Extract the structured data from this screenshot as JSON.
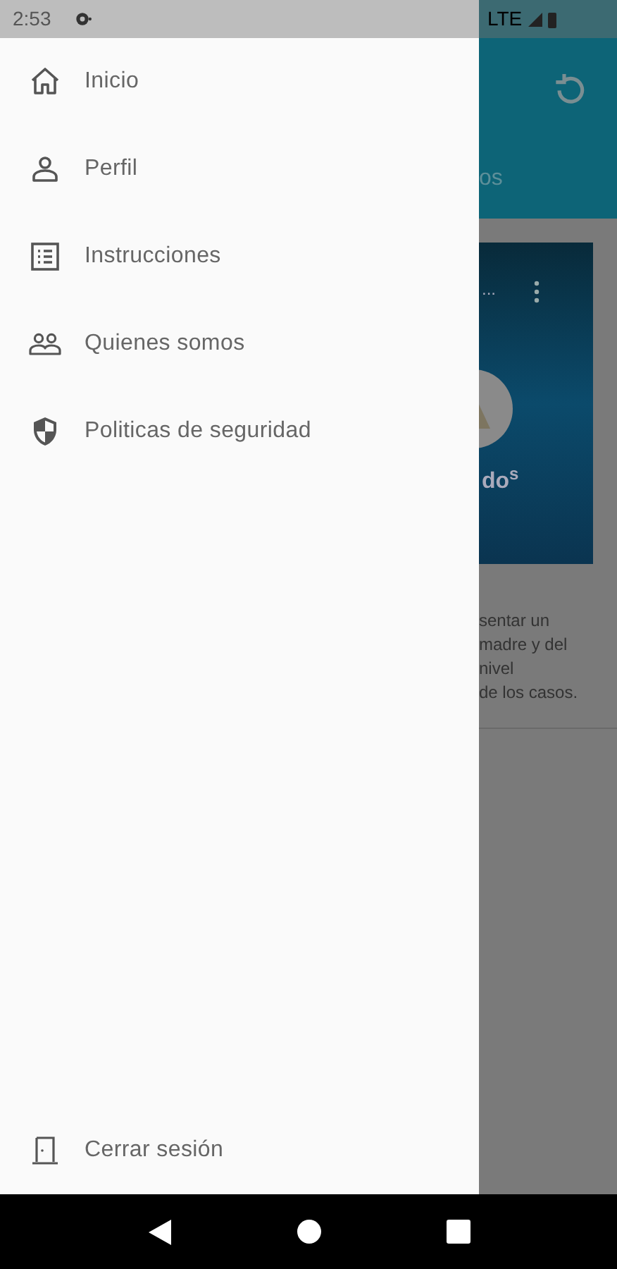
{
  "status_bar": {
    "time": "2:53",
    "network": "LTE"
  },
  "drawer": {
    "items": [
      {
        "kind": "home",
        "label": "Inicio"
      },
      {
        "kind": "person",
        "label": "Perfil"
      },
      {
        "kind": "list",
        "label": "Instrucciones"
      },
      {
        "kind": "people",
        "label": "Quienes somos"
      },
      {
        "kind": "shield",
        "label": "Politicas de seguridad"
      }
    ],
    "footer": {
      "kind": "door",
      "label": "Cerrar sesión"
    }
  },
  "background": {
    "tab_fragment": "os",
    "card": {
      "more": "...",
      "title_fragment": "do$^{s}$"
    },
    "text_lines": [
      "sentar un",
      "madre y del",
      "nivel",
      "de los casos."
    ]
  }
}
